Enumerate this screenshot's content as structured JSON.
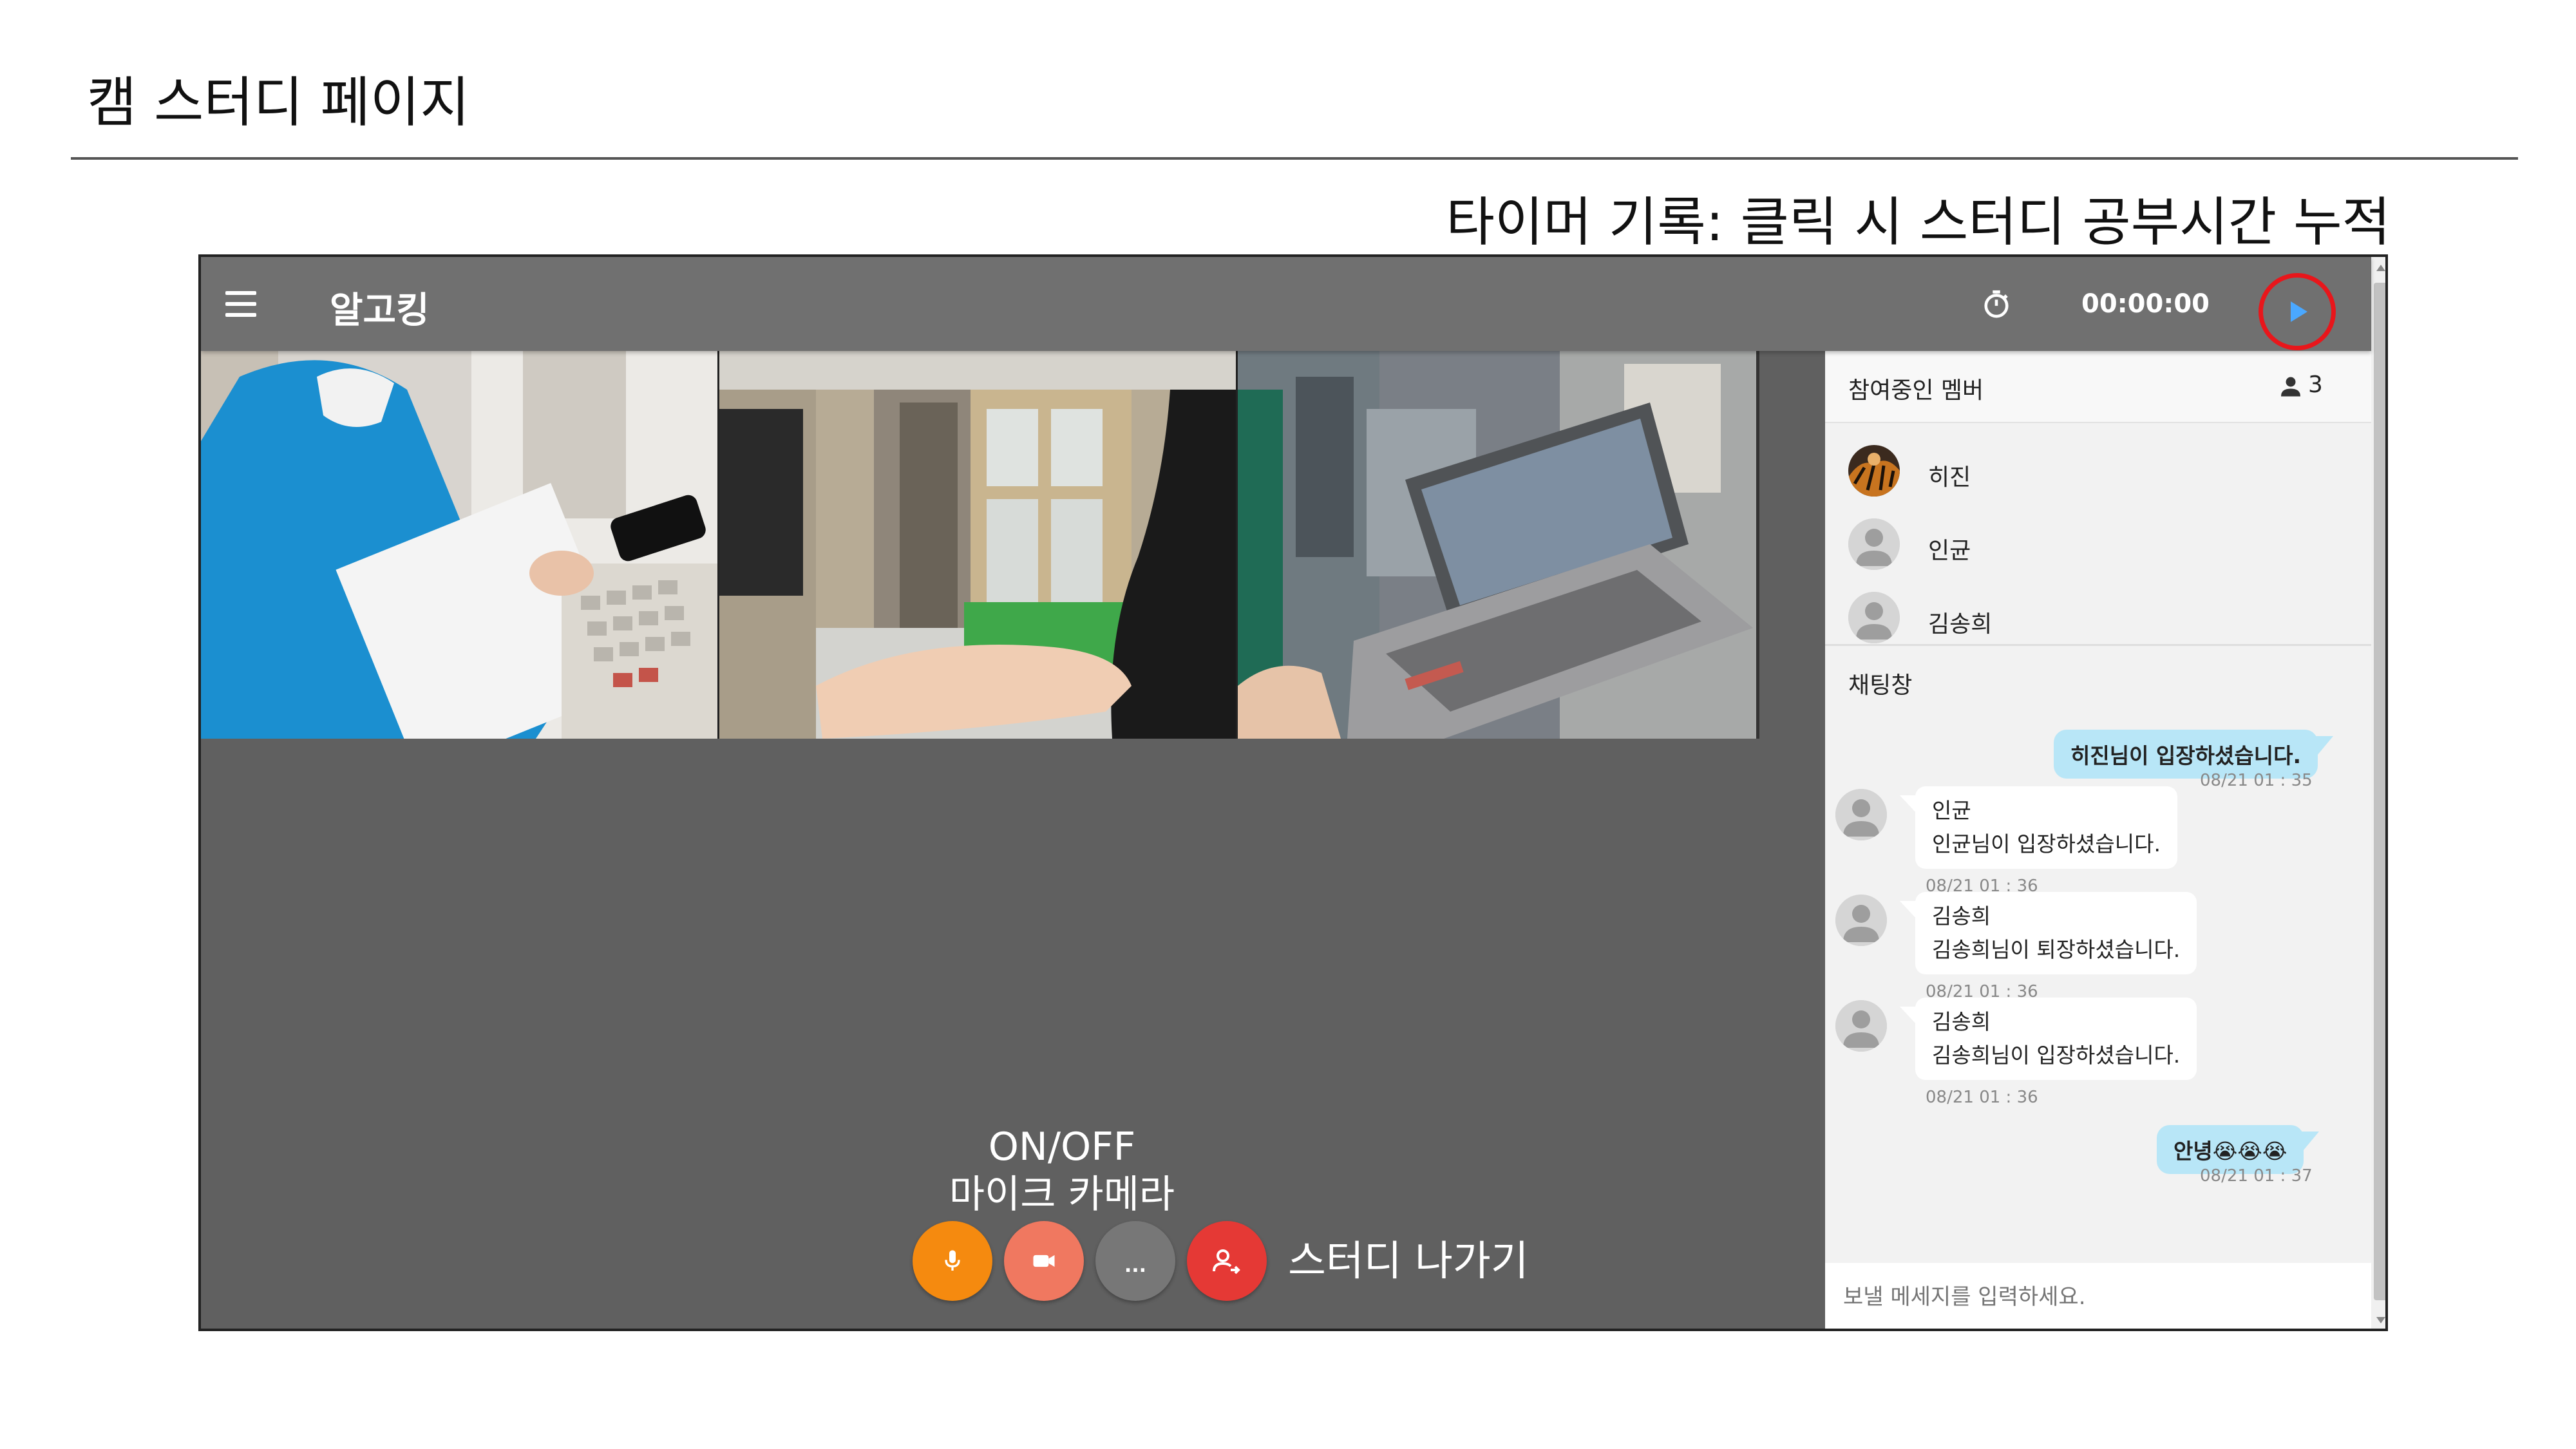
{
  "page": {
    "title": "캠 스터디 페이지",
    "timer_caption": "타이머 기록: 클릭 시 스터디 공부시간 누적"
  },
  "topbar": {
    "app_name": "알고킹",
    "menu_icon": "hamburger-menu-icon",
    "stopwatch_icon": "stopwatch-icon",
    "timer": "00:00:00",
    "play_icon": "play-icon",
    "highlight_color": "#e8161b"
  },
  "video_tiles": [
    {
      "icon": "participant-video-1"
    },
    {
      "icon": "participant-video-2"
    },
    {
      "icon": "participant-video-3"
    }
  ],
  "controls": {
    "onoff_label": "ON/OFF",
    "mic_camera_label": "마이크 카메라",
    "more_label": "...",
    "leave_label": "스터디 나가기",
    "mic_color": "#f58a0f",
    "camera_color": "#f07860",
    "more_color": "#777777",
    "leave_color": "#e53935"
  },
  "members": {
    "title": "참여중인 멤버",
    "count": "3",
    "list": [
      {
        "name": "히진"
      },
      {
        "name": "인균"
      },
      {
        "name": "김송희"
      }
    ]
  },
  "chat": {
    "title": "채팅창",
    "messages": [
      {
        "self": true,
        "text": "히진님이 입장하셨습니다.",
        "time": "08/21 01 : 35"
      },
      {
        "self": false,
        "sender": "인균",
        "text": "인균님이 입장하셨습니다.",
        "time": "08/21 01 : 36"
      },
      {
        "self": false,
        "sender": "김송희",
        "text": "김송희님이 퇴장하셨습니다.",
        "time": "08/21 01 : 36"
      },
      {
        "self": false,
        "sender": "김송희",
        "text": "김송희님이 입장하셨습니다.",
        "time": "08/21 01 : 36"
      },
      {
        "self": true,
        "text": "안녕😭😭😭",
        "time": "08/21 01 : 37"
      }
    ],
    "input_placeholder": "보낼 메세지를 입력하세요."
  }
}
